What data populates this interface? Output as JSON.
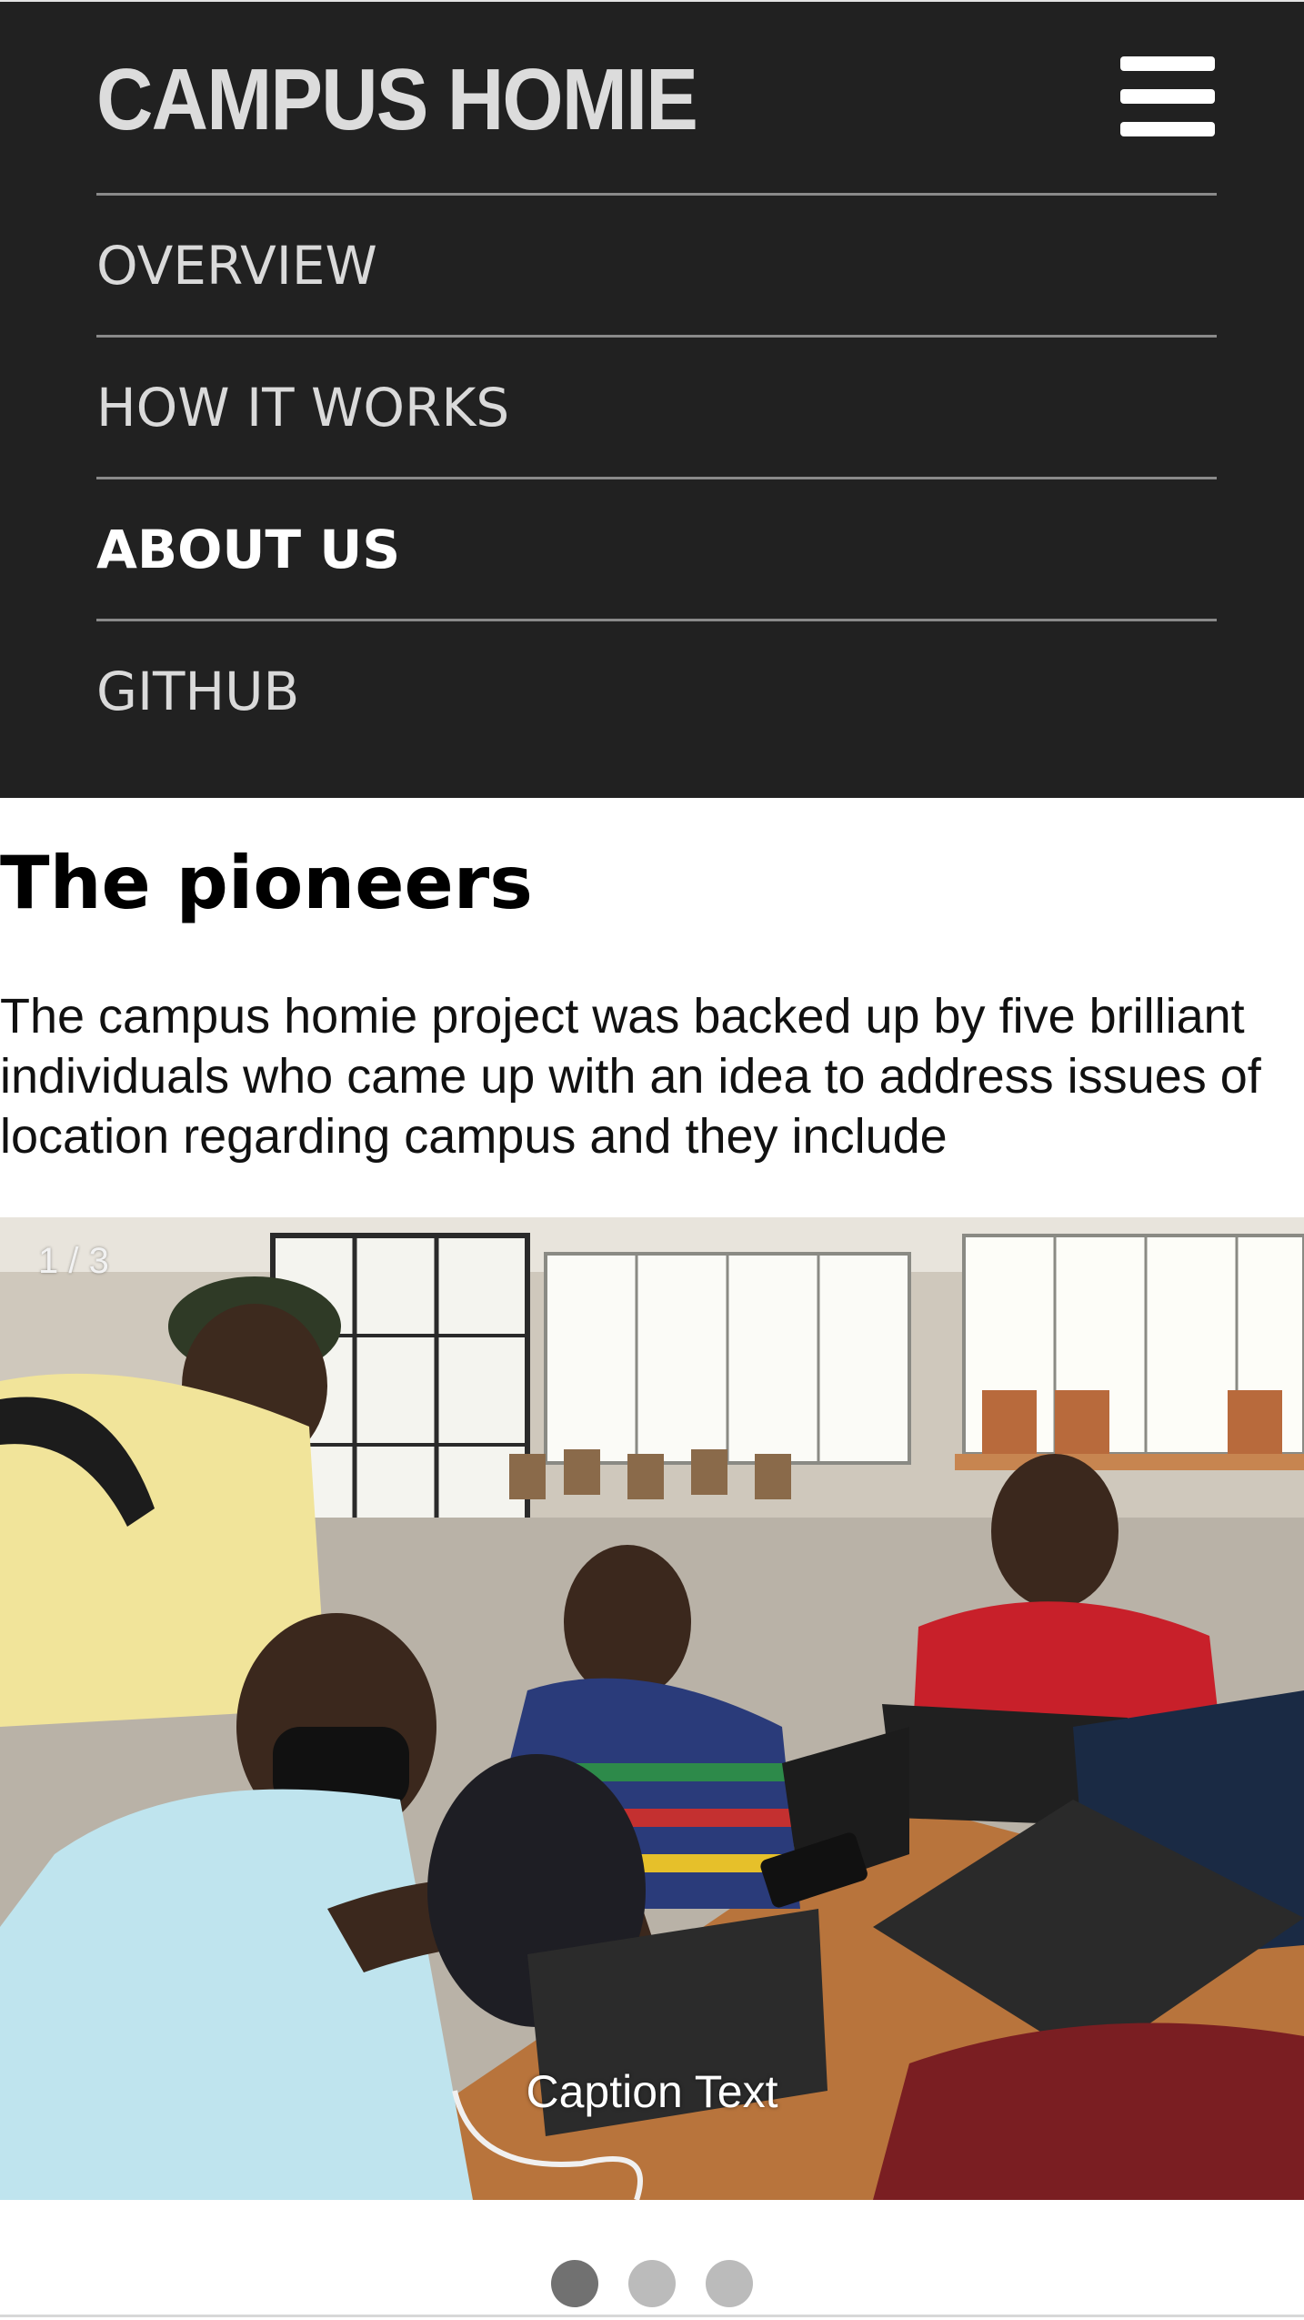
{
  "nav": {
    "brand": "CAMPUS HOMIE",
    "menu_icon": "hamburger-menu-icon",
    "items": [
      {
        "label": "OVERVIEW",
        "active": false
      },
      {
        "label": "HOW IT WORKS",
        "active": false
      },
      {
        "label": "ABOUT US",
        "active": true
      },
      {
        "label": "GITHUB",
        "active": false
      }
    ]
  },
  "section": {
    "title": "The pioneers",
    "body": "The campus homie project was backed up by five brilliant individuals who came up with an idea to address issues of location regarding campus and they include"
  },
  "slideshow": {
    "counter": "1 / 3",
    "caption": "Caption Text",
    "image_subject": "group-photo",
    "slide_count": 3,
    "active_slide": 1
  },
  "colors": {
    "nav_background": "#212121",
    "dot_active": "#717171",
    "dot_inactive": "#bbbbbb"
  }
}
